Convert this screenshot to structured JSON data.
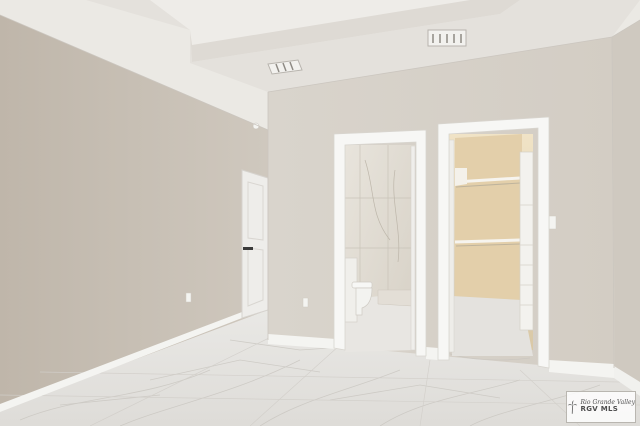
{
  "scene": {
    "description_labels": {
      "room": "bedroom",
      "left_door": "bedroom entry door",
      "center_door": "bathroom doorway",
      "right_door": "walk-in closet doorway"
    }
  },
  "watermark": {
    "line1": "Rio Grande Valley",
    "line2": "RGV MLS"
  },
  "colors": {
    "wall": "#d7d1c8",
    "wall_shadow": "#bdb5aa",
    "ceiling": "#ebe8e3",
    "trim": "#f6f6f3",
    "floor": "#e6e5e2",
    "closet_wall": "#e9d8b7",
    "bath_tile": "#e2ddd4"
  }
}
